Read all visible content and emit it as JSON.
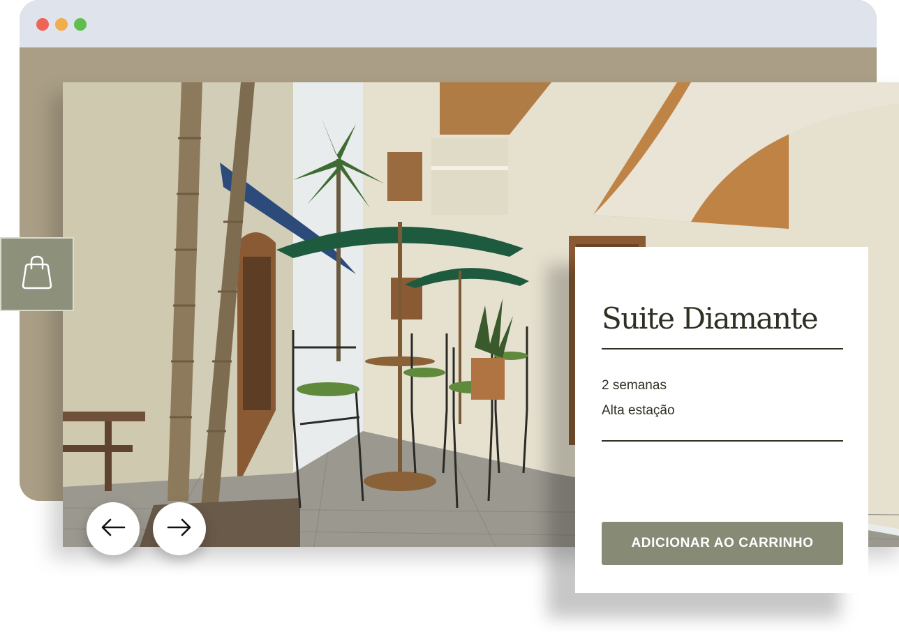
{
  "window": {
    "controls": [
      "close",
      "minimize",
      "maximize"
    ]
  },
  "gallery": {
    "prev_icon": "arrow-left-icon",
    "next_icon": "arrow-right-icon",
    "bag_icon": "shopping-bag-icon"
  },
  "product": {
    "title": "Suite Diamante",
    "duration": "2 semanas",
    "season": "Alta estação",
    "add_to_cart_label": "ADICIONAR AO CARRINHO"
  },
  "colors": {
    "browser_frame": "#aa9f86",
    "titlebar": "#dfe3ec",
    "accent": "#878b76",
    "text_dark": "#2d3022"
  }
}
